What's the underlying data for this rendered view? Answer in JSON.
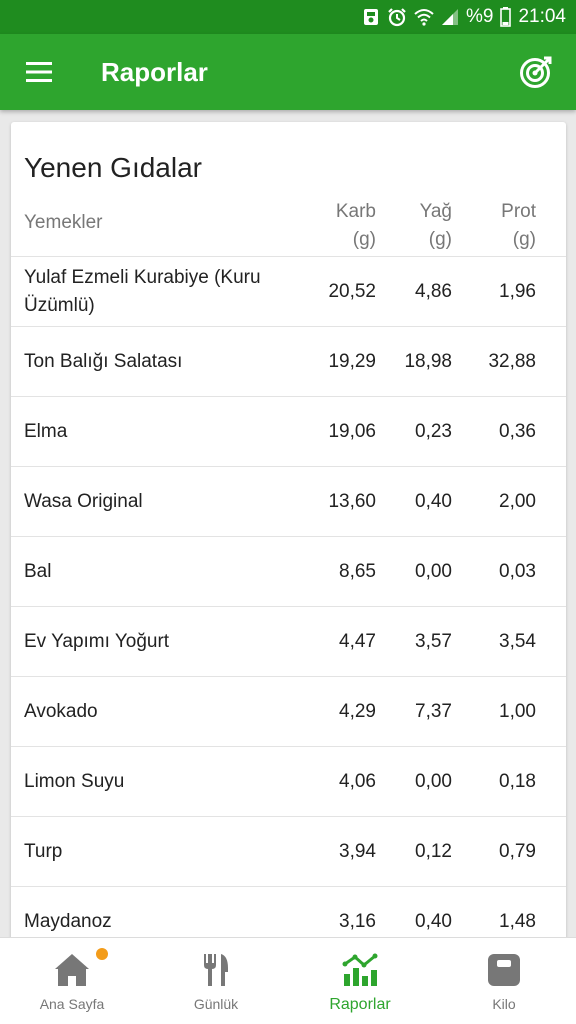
{
  "status_bar": {
    "battery": "%9",
    "time": "21:04"
  },
  "app_bar": {
    "title": "Raporlar",
    "menu_icon": "hamburger-menu-icon",
    "action_icon": "target-goal-icon"
  },
  "card": {
    "title": "Yenen Gıdalar",
    "columns": {
      "name": "Yemekler",
      "carb": "Karb",
      "carb_unit": "(g)",
      "fat": "Yağ",
      "fat_unit": "(g)",
      "prot": "Prot",
      "prot_unit": "(g)"
    },
    "rows": [
      {
        "name": "Yulaf Ezmeli Kurabiye (Kuru Üzümlü)",
        "carb": "20,52",
        "fat": "4,86",
        "prot": "1,96"
      },
      {
        "name": "Ton Balığı Salatası",
        "carb": "19,29",
        "fat": "18,98",
        "prot": "32,88"
      },
      {
        "name": "Elma",
        "carb": "19,06",
        "fat": "0,23",
        "prot": "0,36"
      },
      {
        "name": "Wasa Original",
        "carb": "13,60",
        "fat": "0,40",
        "prot": "2,00"
      },
      {
        "name": "Bal",
        "carb": "8,65",
        "fat": "0,00",
        "prot": "0,03"
      },
      {
        "name": "Ev Yapımı Yoğurt",
        "carb": "4,47",
        "fat": "3,57",
        "prot": "3,54"
      },
      {
        "name": "Avokado",
        "carb": "4,29",
        "fat": "7,37",
        "prot": "1,00"
      },
      {
        "name": "Limon Suyu",
        "carb": "4,06",
        "fat": "0,00",
        "prot": "0,18"
      },
      {
        "name": "Turp",
        "carb": "3,94",
        "fat": "0,12",
        "prot": "0,79"
      },
      {
        "name": "Maydanoz",
        "carb": "3,16",
        "fat": "0,40",
        "prot": "1,48"
      }
    ]
  },
  "bottom_nav": {
    "items": [
      {
        "label": "Ana Sayfa",
        "icon": "home-icon"
      },
      {
        "label": "Günlük",
        "icon": "fork-knife-icon"
      },
      {
        "label": "Raporlar",
        "icon": "chart-icon"
      },
      {
        "label": "Kilo",
        "icon": "scale-icon"
      }
    ]
  },
  "colors": {
    "primary": "#2ea52e",
    "status_bar": "#1f8c1f",
    "badge": "#f39c1a"
  }
}
